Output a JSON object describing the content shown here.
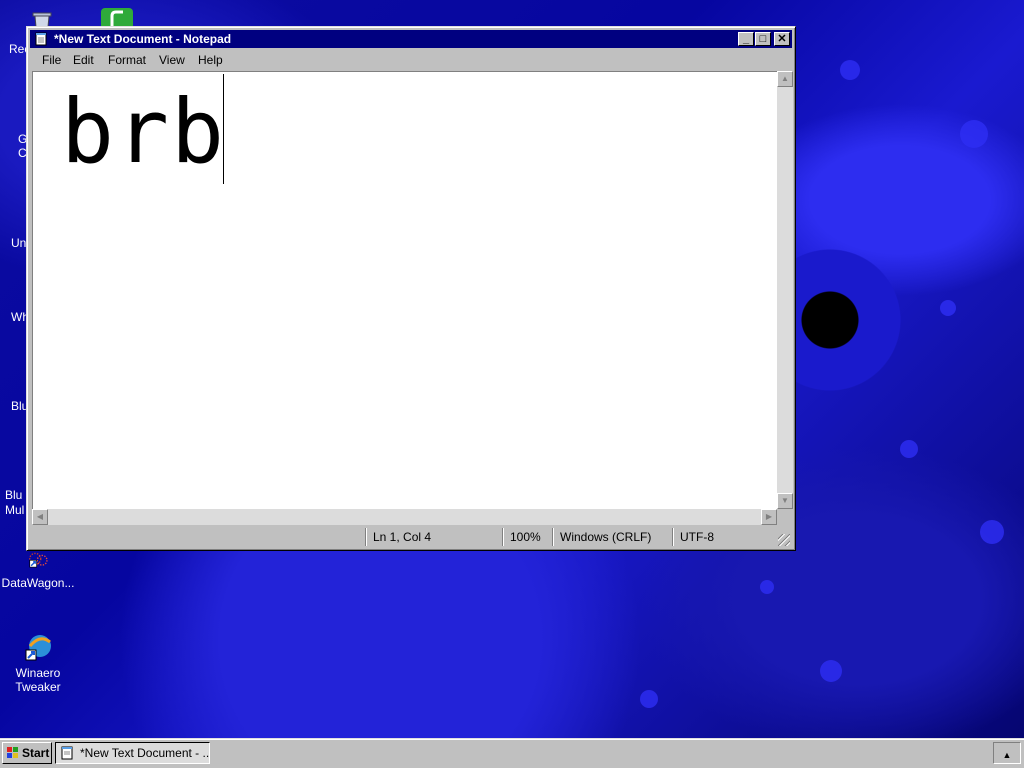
{
  "desktop": {
    "icons": [
      {
        "label": "Rec",
        "icon": "recycle-bin-icon"
      },
      {
        "label": "G\nC",
        "icon": "app-icon"
      },
      {
        "label": "Un",
        "icon": "app-icon"
      },
      {
        "label": "Wh",
        "icon": "app-icon"
      },
      {
        "label": "Blu",
        "icon": "app-icon"
      },
      {
        "label": "Blu\nMul",
        "icon": "app-icon"
      },
      {
        "label": "DataWagon...",
        "icon": "datawagon-icon"
      },
      {
        "label": "Winaero\nTweaker",
        "icon": "winaero-tweaker-icon"
      }
    ]
  },
  "window": {
    "title": "*New Text Document - Notepad",
    "menu": [
      "File",
      "Edit",
      "Format",
      "View",
      "Help"
    ],
    "document_text": "brb",
    "status": {
      "position": "Ln 1, Col 4",
      "zoom": "100%",
      "line_ending": "Windows (CRLF)",
      "encoding": "UTF-8"
    },
    "colors": {
      "titlebar": "#000080",
      "chrome": "#c0c0c0"
    }
  },
  "taskbar": {
    "start_label": "Start",
    "tasks": [
      {
        "label": "*New Text Document - ...",
        "icon": "notepad-icon"
      }
    ],
    "tray_icon": "up-arrow-icon"
  }
}
